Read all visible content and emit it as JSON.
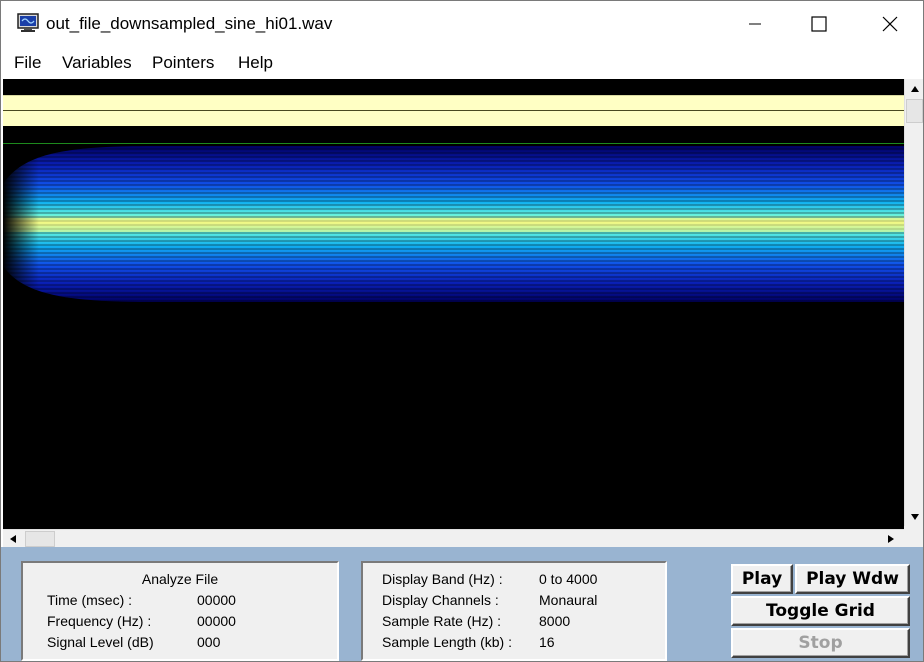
{
  "window": {
    "title": "out_file_downsampled_sine_hi01.wav",
    "icon": "monitor-icon",
    "controls": [
      "minimize-icon",
      "maximize-icon",
      "close-icon"
    ]
  },
  "menu": {
    "items": [
      "File",
      "Variables",
      "Pointers",
      "Help"
    ]
  },
  "spectrogram": {
    "background": "#000000",
    "guide_band_color": "#ffffc4",
    "signal_peak_color": "#f0f882"
  },
  "analyze": {
    "heading": "Analyze File",
    "rows": [
      {
        "label": "Time (msec) :",
        "value": "00000"
      },
      {
        "label": "Frequency (Hz) :",
        "value": "00000"
      },
      {
        "label": "Signal Level (dB)",
        "value": "000"
      }
    ]
  },
  "info": {
    "rows": [
      {
        "label": "Display Band (Hz) :",
        "value": "0 to 4000"
      },
      {
        "label": "Display Channels :",
        "value": "Monaural"
      },
      {
        "label": "Sample Rate (Hz) :",
        "value": "8000"
      },
      {
        "label": "Sample Length (kb) :",
        "value": "16"
      }
    ]
  },
  "buttons": {
    "play": "Play",
    "play_wdw": "Play Wdw",
    "toggle_grid": "Toggle Grid",
    "stop": "Stop"
  },
  "colors": {
    "bottom_background": "#99b4d1",
    "panel_background": "#f0f0f0"
  }
}
